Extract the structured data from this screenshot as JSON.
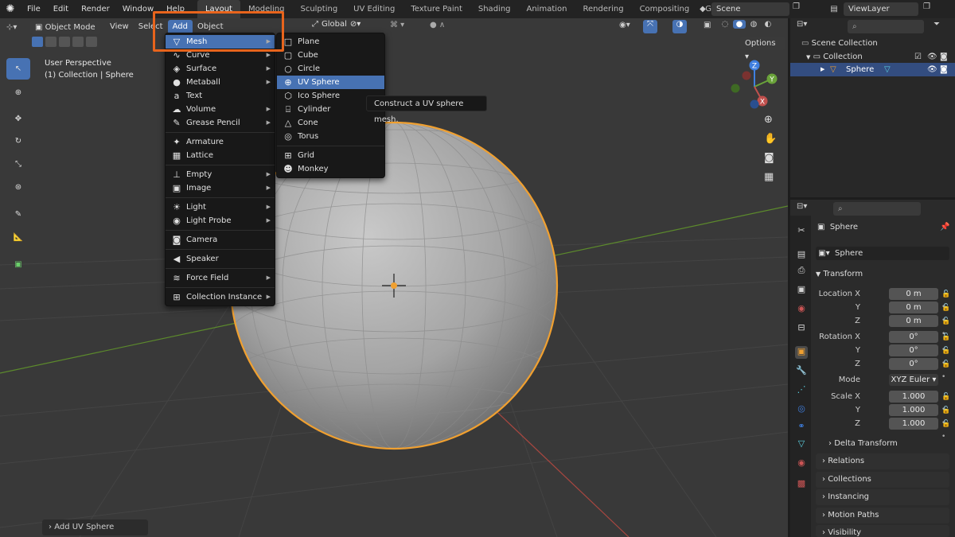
{
  "topbar": {
    "menus": [
      "File",
      "Edit",
      "Render",
      "Window",
      "Help"
    ],
    "workspaces": [
      "Layout",
      "Modeling",
      "Sculpting",
      "UV Editing",
      "Texture Paint",
      "Shading",
      "Animation",
      "Rendering",
      "Compositing",
      "Geometry Nodes"
    ],
    "active_workspace": "Layout",
    "scene": "Scene",
    "view_layer": "ViewLayer"
  },
  "viewport": {
    "mode": "Object Mode",
    "header_menus": [
      "View",
      "Select",
      "Add",
      "Object"
    ],
    "active_menu": "Add",
    "orientation": "Global",
    "options_label": "Options",
    "info_line1": "User Perspective",
    "info_line2": "(1) Collection | Sphere",
    "last_op": "Add UV Sphere",
    "gizmo": {
      "z": "Z",
      "y": "Y",
      "x": "X"
    }
  },
  "add_menu": {
    "items": [
      {
        "label": "Mesh",
        "icon": "mesh-icon",
        "glyph": "▽",
        "sub": true,
        "highlight": true
      },
      {
        "label": "Curve",
        "icon": "curve-icon",
        "glyph": "∿",
        "sub": true
      },
      {
        "label": "Surface",
        "icon": "surface-icon",
        "glyph": "◈",
        "sub": true
      },
      {
        "label": "Metaball",
        "icon": "metaball-icon",
        "glyph": "●",
        "sub": true
      },
      {
        "label": "Text",
        "icon": "text-icon",
        "glyph": "a",
        "sub": false
      },
      {
        "label": "Volume",
        "icon": "volume-icon",
        "glyph": "☁",
        "sub": true
      },
      {
        "label": "Grease Pencil",
        "icon": "grease-pencil-icon",
        "glyph": "✎",
        "sub": true,
        "sep_after": true
      },
      {
        "label": "Armature",
        "icon": "armature-icon",
        "glyph": "✦",
        "sub": false
      },
      {
        "label": "Lattice",
        "icon": "lattice-icon",
        "glyph": "▦",
        "sub": false,
        "sep_after": true
      },
      {
        "label": "Empty",
        "icon": "empty-icon",
        "glyph": "⊥",
        "sub": true
      },
      {
        "label": "Image",
        "icon": "image-icon",
        "glyph": "▣",
        "sub": true,
        "sep_after": true
      },
      {
        "label": "Light",
        "icon": "light-icon",
        "glyph": "☀",
        "sub": true
      },
      {
        "label": "Light Probe",
        "icon": "light-probe-icon",
        "glyph": "◉",
        "sub": true,
        "sep_after": true
      },
      {
        "label": "Camera",
        "icon": "camera-icon",
        "glyph": "◙",
        "sub": false,
        "sep_after": true
      },
      {
        "label": "Speaker",
        "icon": "speaker-icon",
        "glyph": "◀",
        "sub": false,
        "sep_after": true
      },
      {
        "label": "Force Field",
        "icon": "force-field-icon",
        "glyph": "≋",
        "sub": true,
        "sep_after": true
      },
      {
        "label": "Collection Instance",
        "icon": "collection-instance-icon",
        "glyph": "⊞",
        "sub": true
      }
    ]
  },
  "mesh_menu": {
    "items": [
      {
        "label": "Plane",
        "icon": "plane-icon",
        "glyph": "□"
      },
      {
        "label": "Cube",
        "icon": "cube-icon",
        "glyph": "▢"
      },
      {
        "label": "Circle",
        "icon": "circle-icon",
        "glyph": "○"
      },
      {
        "label": "UV Sphere",
        "icon": "uv-sphere-icon",
        "glyph": "⊕",
        "highlight": true
      },
      {
        "label": "Ico Sphere",
        "icon": "ico-sphere-icon",
        "glyph": "⬡"
      },
      {
        "label": "Cylinder",
        "icon": "cylinder-icon",
        "glyph": "⌸"
      },
      {
        "label": "Cone",
        "icon": "cone-icon",
        "glyph": "△"
      },
      {
        "label": "Torus",
        "icon": "torus-icon",
        "glyph": "◎",
        "sep_after": true
      },
      {
        "label": "Grid",
        "icon": "grid-icon",
        "glyph": "⊞"
      },
      {
        "label": "Monkey",
        "icon": "monkey-icon",
        "glyph": "☻"
      }
    ]
  },
  "tooltip": "Construct a UV sphere mesh.",
  "outliner": {
    "root": "Scene Collection",
    "collection": "Collection",
    "object": "Sphere"
  },
  "properties": {
    "object_name": "Sphere",
    "data_name": "Sphere",
    "transform_label": "Transform",
    "location": {
      "label": "Location X",
      "x": "0 m",
      "y": "0 m",
      "z": "0 m"
    },
    "rotation": {
      "label": "Rotation X",
      "x": "0°",
      "y": "0°",
      "z": "0°"
    },
    "mode_label": "Mode",
    "mode_value": "XYZ Euler",
    "scale": {
      "label": "Scale X",
      "x": "1.000",
      "y": "1.000",
      "z": "1.000"
    },
    "axis_y": "Y",
    "axis_z": "Z",
    "panels": [
      "Delta Transform",
      "Relations",
      "Collections",
      "Instancing",
      "Motion Paths",
      "Visibility"
    ]
  },
  "colors": {
    "accent": "#4772b3",
    "selection_outline": "#f0a030",
    "annotation_box": "#e8641c",
    "x_axis": "#c0504d",
    "y_axis": "#6aa33a",
    "z_axis": "#3f7fe0"
  }
}
